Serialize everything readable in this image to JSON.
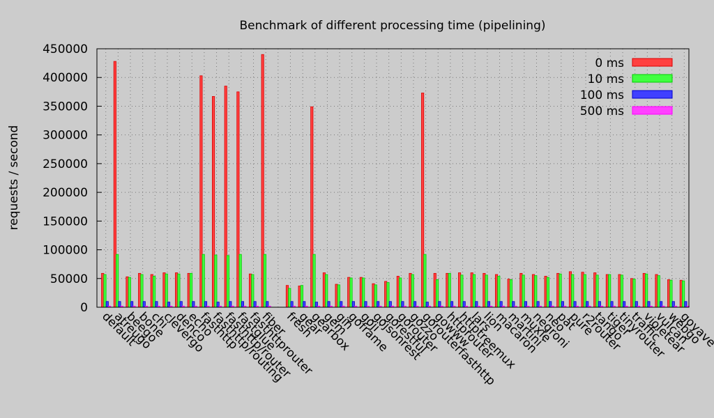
{
  "chart_data": {
    "type": "bar",
    "title": "Benchmark of different processing time (pipelining)",
    "xlabel": "",
    "ylabel": "requests / second",
    "ylim": [
      0,
      450000
    ],
    "yticks": [
      "0",
      "50000",
      "100000",
      "150000",
      "200000",
      "250000",
      "300000",
      "350000",
      "400000",
      "450000"
    ],
    "grid": true,
    "legend_position": "top-right",
    "categories": [
      "default",
      "atreugo",
      "beego",
      "bone",
      "chi",
      "clevergo",
      "denco",
      "echo",
      "fasthttp",
      "fasthttp/routing",
      "fasthttp/router",
      "fastglue",
      "fasthttprouter",
      "fiber",
      "",
      "fresh",
      "gear",
      "gearbox",
      "gem",
      "gin",
      "goframe",
      "goji",
      "gojsonrest",
      "gorestful",
      "gorouter",
      "gozzo",
      "gorouterfasthttp",
      "gowww",
      "httprouter",
      "httptreemux",
      "lars",
      "lion",
      "macaron",
      "martini",
      "muxie",
      "negroni",
      "neo",
      "pat",
      "pure",
      "r2router",
      "tango",
      "tiger",
      "tinyrouter",
      "traffic",
      "violetear",
      "vulcan",
      "webgo",
      "goyave"
    ],
    "series": [
      {
        "name": "0 ms",
        "color": "#ff4040",
        "values": [
          59000,
          428000,
          53000,
          59000,
          57000,
          60000,
          60000,
          59000,
          403000,
          367000,
          385000,
          375000,
          58000,
          440000,
          null,
          38000,
          37000,
          349000,
          60000,
          40000,
          52000,
          52000,
          41000,
          45000,
          54000,
          59000,
          373000,
          59000,
          59000,
          60000,
          60000,
          59000,
          57000,
          49000,
          59000,
          57000,
          54000,
          59000,
          62000,
          61000,
          60000,
          57000,
          57000,
          50000,
          59000,
          57000,
          48000,
          47000
        ]
      },
      {
        "name": "10 ms",
        "color": "#40ff40",
        "values": [
          57000,
          92000,
          52000,
          57000,
          54000,
          58000,
          58000,
          59000,
          92000,
          91000,
          90000,
          92000,
          57000,
          92000,
          null,
          33000,
          38000,
          92000,
          57000,
          39000,
          51000,
          51000,
          39000,
          43000,
          51000,
          57000,
          92000,
          48000,
          59000,
          56000,
          57000,
          56000,
          54000,
          48000,
          56000,
          55000,
          52000,
          58000,
          57000,
          57000,
          56000,
          57000,
          56000,
          49000,
          58000,
          55000,
          47000,
          46000
        ]
      },
      {
        "name": "100 ms",
        "color": "#4040ff",
        "values": [
          10000,
          10000,
          10000,
          10000,
          10000,
          9000,
          10000,
          10000,
          10000,
          9000,
          10000,
          10000,
          10000,
          10000,
          null,
          10000,
          10000,
          9000,
          10000,
          10000,
          10000,
          10000,
          10000,
          10000,
          10000,
          10000,
          9000,
          10000,
          10000,
          10000,
          10000,
          10000,
          10000,
          10000,
          10000,
          10000,
          10000,
          10000,
          10000,
          10000,
          10000,
          10000,
          10000,
          10000,
          10000,
          10000,
          10000,
          10000
        ]
      },
      {
        "name": "500 ms",
        "color": "#ff40ff",
        "values": [
          2000,
          2000,
          2000,
          2000,
          2000,
          2000,
          2000,
          2000,
          2000,
          2000,
          2000,
          2000,
          2000,
          2000,
          null,
          2000,
          2000,
          2000,
          2000,
          2000,
          2000,
          2000,
          2000,
          2000,
          2000,
          2000,
          2000,
          2000,
          2000,
          2000,
          2000,
          2000,
          2000,
          2000,
          2000,
          2000,
          2000,
          2000,
          2000,
          2000,
          2000,
          2000,
          2000,
          2000,
          2000,
          2000,
          2000,
          2000
        ]
      }
    ]
  }
}
